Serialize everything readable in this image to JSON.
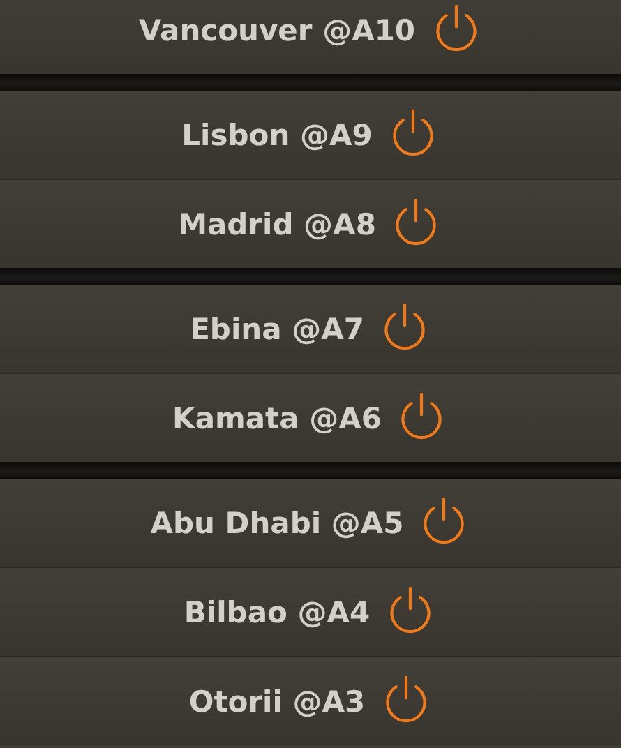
{
  "groups": [
    {
      "items": [
        {
          "label": "Vancouver @A10"
        }
      ]
    },
    {
      "items": [
        {
          "label": "Lisbon @A9"
        },
        {
          "label": "Madrid @A8"
        }
      ]
    },
    {
      "items": [
        {
          "label": "Ebina @A7"
        },
        {
          "label": "Kamata @A6"
        }
      ]
    },
    {
      "items": [
        {
          "label": "Abu Dhabi @A5"
        },
        {
          "label": "Bilbao @A4"
        },
        {
          "label": "Otorii @A3"
        }
      ]
    }
  ]
}
